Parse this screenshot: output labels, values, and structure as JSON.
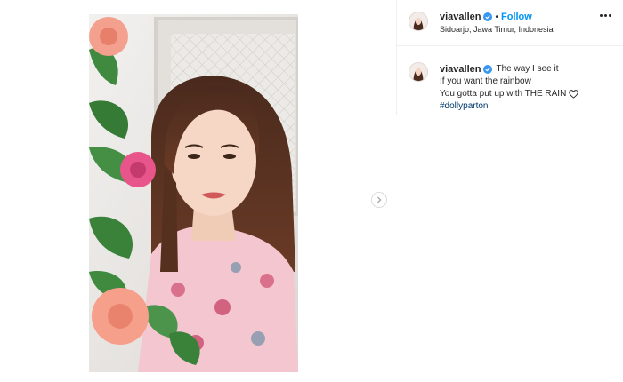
{
  "post": {
    "username": "viavallen",
    "follow_label": "Follow",
    "separator": "•",
    "location": "Sidoarjo, Jawa Timur, Indonesia"
  },
  "caption": {
    "username": "viavallen",
    "line1": "The way I see it",
    "line2": "If you want the rainbow",
    "line3": "You gotta put up with THE RAIN",
    "hashtag": "#dollyparton"
  },
  "icons": {
    "verified": "verified-badge-icon",
    "heart": "heart-icon",
    "next": "chevron-right-icon",
    "more": "more-options-icon"
  },
  "colors": {
    "accent": "#0095f6",
    "hashtag": "#00376b",
    "text": "#262626",
    "divider": "#efefef"
  }
}
